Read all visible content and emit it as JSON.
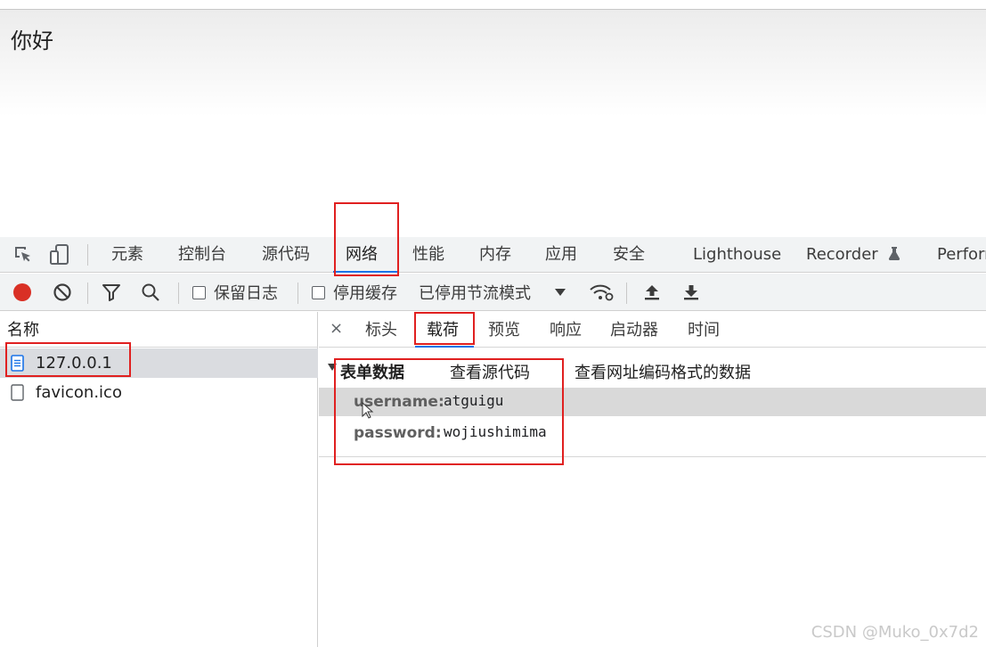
{
  "page": {
    "greeting": "你好"
  },
  "devtools": {
    "main_tabs": [
      "元素",
      "控制台",
      "源代码",
      "网络",
      "性能",
      "内存",
      "应用",
      "安全",
      "Lighthouse",
      "Recorder",
      "Perforr"
    ],
    "active_main_tab": "网络",
    "toolbar": {
      "preserve_log": "保留日志",
      "disable_cache": "停用缓存",
      "throttling": "已停用节流模式"
    },
    "requests": {
      "header": "名称",
      "items": [
        "127.0.0.1",
        "favicon.ico"
      ],
      "selected": "127.0.0.1"
    },
    "detail": {
      "close": "×",
      "tabs": [
        "标头",
        "载荷",
        "预览",
        "响应",
        "启动器",
        "时间"
      ],
      "active_tab": "载荷",
      "section_title": "表单数据",
      "view_source": "查看源代码",
      "view_url_encoded": "查看网址编码格式的数据",
      "fields": [
        {
          "key": "username:",
          "value": "atguigu"
        },
        {
          "key": "password:",
          "value": "wojiushimima"
        }
      ]
    },
    "colors": {
      "accent": "#1a73e8",
      "record": "#d93025",
      "annotation": "#e02020"
    }
  },
  "watermark": "CSDN @Muko_0x7d2"
}
